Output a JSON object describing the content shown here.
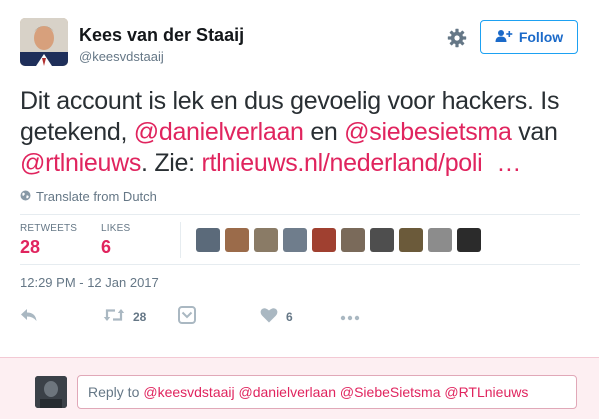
{
  "author": {
    "name": "Kees van der Staaij",
    "handle": "@keesvdstaaij"
  },
  "header": {
    "gear_icon": "gear-icon",
    "follow_label": "Follow",
    "follow_icon": "add-user-icon"
  },
  "tweet": {
    "line1_text": "Dit account is lek en dus gevoelig voor hackers. Is",
    "line2_pre": "getekend, ",
    "mention1": "@danielverlaan",
    "line2_mid": " en ",
    "mention2": "@siebesietsma",
    "line2_post": " van",
    "mention3": "@rtlnieuws",
    "line3_mid": ". Zie: ",
    "link": "rtlnieuws.nl/nederland/poli",
    "ellipsis": "…",
    "link_color": "#e0245e"
  },
  "translate": {
    "label": "Translate from Dutch",
    "icon": "globe-icon"
  },
  "stats": {
    "retweets_label": "RETWEETS",
    "retweets_value": "28",
    "likes_label": "LIKES",
    "likes_value": "6"
  },
  "likers": [
    "#5b6a7a",
    "#9b6b4a",
    "#8a7b66",
    "#6f7d8c",
    "#a04030",
    "#7a6a5a",
    "#4e4e4e",
    "#6b5a3a",
    "#8c8c8c",
    "#2b2b2b"
  ],
  "timestamp": "12:29 PM - 12 Jan 2017",
  "actions": {
    "reply_icon": "reply-icon",
    "retweet_icon": "retweet-icon",
    "retweet_count": "28",
    "dm_icon": "direct-message-icon",
    "like_icon": "heart-icon",
    "like_count": "6",
    "more_icon": "more-icon"
  },
  "reply": {
    "prefix": "Reply to",
    "mentions": "@keesvdstaaij @danielverlaan @SiebeSietsma @RTLnieuws"
  }
}
